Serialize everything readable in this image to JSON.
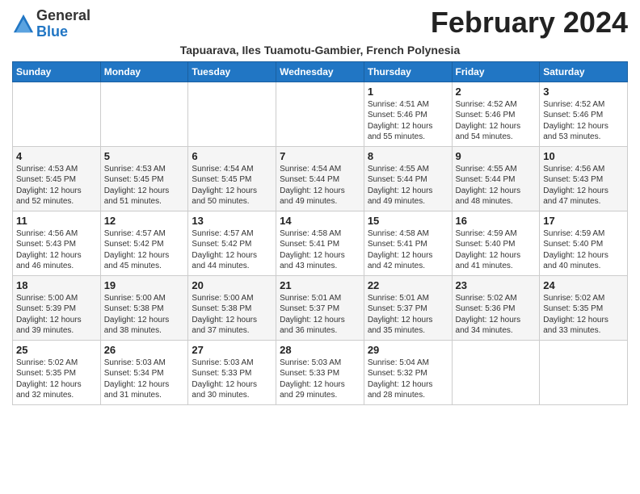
{
  "header": {
    "logo_general": "General",
    "logo_blue": "Blue",
    "month_title": "February 2024",
    "subtitle": "Tapuarava, Iles Tuamotu-Gambier, French Polynesia"
  },
  "days_of_week": [
    "Sunday",
    "Monday",
    "Tuesday",
    "Wednesday",
    "Thursday",
    "Friday",
    "Saturday"
  ],
  "weeks": [
    [
      {
        "day": "",
        "info": ""
      },
      {
        "day": "",
        "info": ""
      },
      {
        "day": "",
        "info": ""
      },
      {
        "day": "",
        "info": ""
      },
      {
        "day": "1",
        "info": "Sunrise: 4:51 AM\nSunset: 5:46 PM\nDaylight: 12 hours\nand 55 minutes."
      },
      {
        "day": "2",
        "info": "Sunrise: 4:52 AM\nSunset: 5:46 PM\nDaylight: 12 hours\nand 54 minutes."
      },
      {
        "day": "3",
        "info": "Sunrise: 4:52 AM\nSunset: 5:46 PM\nDaylight: 12 hours\nand 53 minutes."
      }
    ],
    [
      {
        "day": "4",
        "info": "Sunrise: 4:53 AM\nSunset: 5:45 PM\nDaylight: 12 hours\nand 52 minutes."
      },
      {
        "day": "5",
        "info": "Sunrise: 4:53 AM\nSunset: 5:45 PM\nDaylight: 12 hours\nand 51 minutes."
      },
      {
        "day": "6",
        "info": "Sunrise: 4:54 AM\nSunset: 5:45 PM\nDaylight: 12 hours\nand 50 minutes."
      },
      {
        "day": "7",
        "info": "Sunrise: 4:54 AM\nSunset: 5:44 PM\nDaylight: 12 hours\nand 49 minutes."
      },
      {
        "day": "8",
        "info": "Sunrise: 4:55 AM\nSunset: 5:44 PM\nDaylight: 12 hours\nand 49 minutes."
      },
      {
        "day": "9",
        "info": "Sunrise: 4:55 AM\nSunset: 5:44 PM\nDaylight: 12 hours\nand 48 minutes."
      },
      {
        "day": "10",
        "info": "Sunrise: 4:56 AM\nSunset: 5:43 PM\nDaylight: 12 hours\nand 47 minutes."
      }
    ],
    [
      {
        "day": "11",
        "info": "Sunrise: 4:56 AM\nSunset: 5:43 PM\nDaylight: 12 hours\nand 46 minutes."
      },
      {
        "day": "12",
        "info": "Sunrise: 4:57 AM\nSunset: 5:42 PM\nDaylight: 12 hours\nand 45 minutes."
      },
      {
        "day": "13",
        "info": "Sunrise: 4:57 AM\nSunset: 5:42 PM\nDaylight: 12 hours\nand 44 minutes."
      },
      {
        "day": "14",
        "info": "Sunrise: 4:58 AM\nSunset: 5:41 PM\nDaylight: 12 hours\nand 43 minutes."
      },
      {
        "day": "15",
        "info": "Sunrise: 4:58 AM\nSunset: 5:41 PM\nDaylight: 12 hours\nand 42 minutes."
      },
      {
        "day": "16",
        "info": "Sunrise: 4:59 AM\nSunset: 5:40 PM\nDaylight: 12 hours\nand 41 minutes."
      },
      {
        "day": "17",
        "info": "Sunrise: 4:59 AM\nSunset: 5:40 PM\nDaylight: 12 hours\nand 40 minutes."
      }
    ],
    [
      {
        "day": "18",
        "info": "Sunrise: 5:00 AM\nSunset: 5:39 PM\nDaylight: 12 hours\nand 39 minutes."
      },
      {
        "day": "19",
        "info": "Sunrise: 5:00 AM\nSunset: 5:38 PM\nDaylight: 12 hours\nand 38 minutes."
      },
      {
        "day": "20",
        "info": "Sunrise: 5:00 AM\nSunset: 5:38 PM\nDaylight: 12 hours\nand 37 minutes."
      },
      {
        "day": "21",
        "info": "Sunrise: 5:01 AM\nSunset: 5:37 PM\nDaylight: 12 hours\nand 36 minutes."
      },
      {
        "day": "22",
        "info": "Sunrise: 5:01 AM\nSunset: 5:37 PM\nDaylight: 12 hours\nand 35 minutes."
      },
      {
        "day": "23",
        "info": "Sunrise: 5:02 AM\nSunset: 5:36 PM\nDaylight: 12 hours\nand 34 minutes."
      },
      {
        "day": "24",
        "info": "Sunrise: 5:02 AM\nSunset: 5:35 PM\nDaylight: 12 hours\nand 33 minutes."
      }
    ],
    [
      {
        "day": "25",
        "info": "Sunrise: 5:02 AM\nSunset: 5:35 PM\nDaylight: 12 hours\nand 32 minutes."
      },
      {
        "day": "26",
        "info": "Sunrise: 5:03 AM\nSunset: 5:34 PM\nDaylight: 12 hours\nand 31 minutes."
      },
      {
        "day": "27",
        "info": "Sunrise: 5:03 AM\nSunset: 5:33 PM\nDaylight: 12 hours\nand 30 minutes."
      },
      {
        "day": "28",
        "info": "Sunrise: 5:03 AM\nSunset: 5:33 PM\nDaylight: 12 hours\nand 29 minutes."
      },
      {
        "day": "29",
        "info": "Sunrise: 5:04 AM\nSunset: 5:32 PM\nDaylight: 12 hours\nand 28 minutes."
      },
      {
        "day": "",
        "info": ""
      },
      {
        "day": "",
        "info": ""
      }
    ]
  ]
}
